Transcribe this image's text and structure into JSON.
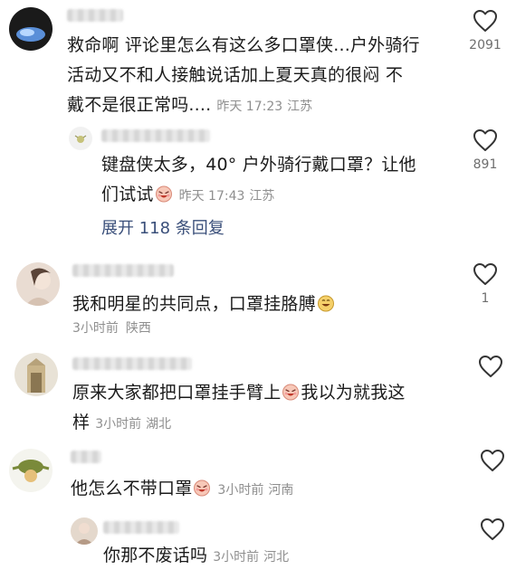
{
  "comments": [
    {
      "text_lines": [
        "救命啊 评论里怎么有这么多口罩侠...户外骑行",
        "活动又不和人接触说话加上夏天真的很闷 不",
        "戴不是很正常吗...."
      ],
      "time": "昨天 17:23",
      "location": "江苏",
      "likes": "2091"
    },
    {
      "text_lines": [
        "键盘侠太多，40° 户外骑行戴口罩？让他",
        "们试试"
      ],
      "emoji": "laughing-emoji",
      "time": "昨天 17:43",
      "location": "江苏",
      "likes": "891",
      "expand_label": "展开 118 条回复"
    },
    {
      "text": "我和明星的共同点，口罩挂胳膊",
      "emoji": "grin-emoji",
      "time": "3小时前",
      "location": "陕西",
      "likes": "1"
    },
    {
      "text_lines": [
        "原来大家都把口罩挂手臂上",
        "我以为就我这",
        "样"
      ],
      "emoji": "laughing-emoji",
      "time": "3小时前",
      "location": "湖北"
    },
    {
      "text": "他怎么不带口罩",
      "emoji": "laughing-emoji",
      "time": "3小时前",
      "location": "河南"
    },
    {
      "text": "你那不废话吗",
      "time": "3小时前",
      "location": "河北"
    }
  ],
  "colors": {
    "text": "#1b1b1b",
    "meta": "#8f8f8f",
    "expand_link": "#3a4f7a",
    "background": "#ffffff"
  }
}
